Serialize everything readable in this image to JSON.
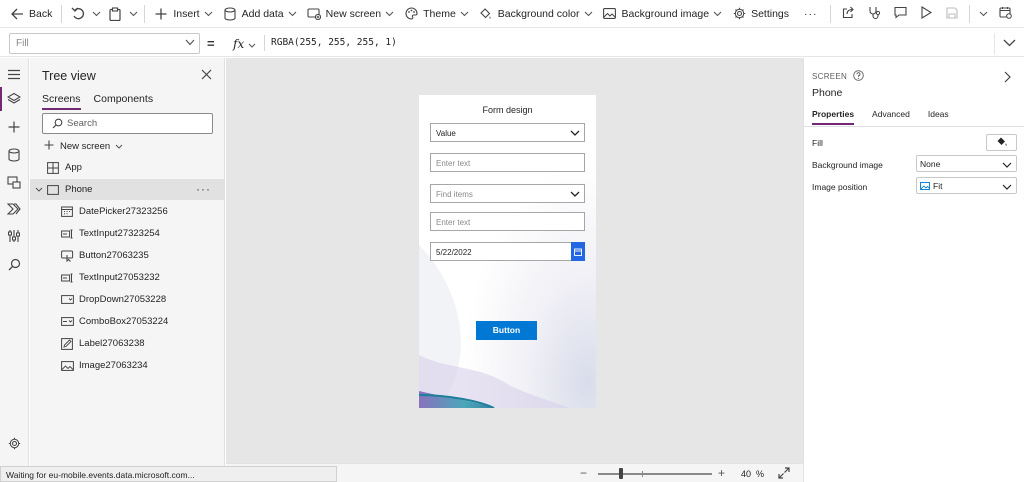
{
  "toolbar": {
    "back_label": "Back",
    "insert_label": "Insert",
    "add_data_label": "Add data",
    "new_screen_label": "New screen",
    "theme_label": "Theme",
    "background_color_label": "Background color",
    "background_image_label": "Background image",
    "settings_label": "Settings",
    "more_label": "···"
  },
  "formula_bar": {
    "property": "Fill",
    "equals": "=",
    "fx_label": "fx",
    "formula": "RGBA(255, 255, 255, 1)"
  },
  "tree": {
    "title": "Tree view",
    "tabs": [
      "Screens",
      "Components"
    ],
    "search_placeholder": "Search",
    "new_screen_label": "New screen",
    "app_label": "App",
    "screen_label": "Phone",
    "more_label": "···",
    "items": [
      {
        "label": "DatePicker27323256",
        "icon": "calendar-icon"
      },
      {
        "label": "TextInput27323254",
        "icon": "text-input-icon"
      },
      {
        "label": "Button27063235",
        "icon": "button-icon"
      },
      {
        "label": "TextInput27053232",
        "icon": "text-input-icon"
      },
      {
        "label": "DropDown27053228",
        "icon": "dropdown-icon"
      },
      {
        "label": "ComboBox27053224",
        "icon": "combobox-icon"
      },
      {
        "label": "Label27063238",
        "icon": "label-edit-icon"
      },
      {
        "label": "Image27063234",
        "icon": "image-icon"
      }
    ]
  },
  "canvas": {
    "form_title": "Form design",
    "dropdown_value": "Value",
    "text_input_1_placeholder": "Enter text",
    "combobox_placeholder": "Find items",
    "text_input_2_placeholder": "Enter text",
    "date_value": "5/22/2022",
    "button_label": "Button",
    "zoom_percent": "40",
    "zoom_unit": "%",
    "zoom_level": 0.2
  },
  "status_text": "Waiting for eu-mobile.events.data.microsoft.com...",
  "properties": {
    "kind": "SCREEN",
    "name": "Phone",
    "tabs": [
      "Properties",
      "Advanced",
      "Ideas"
    ],
    "fill_label": "Fill",
    "background_image_label": "Background image",
    "background_image_value": "None",
    "image_position_label": "Image position",
    "image_position_value": "Fit"
  },
  "colors": {
    "accent": "#742774",
    "button_blue": "#0078d4",
    "date_icon_blue": "#2266e3"
  }
}
